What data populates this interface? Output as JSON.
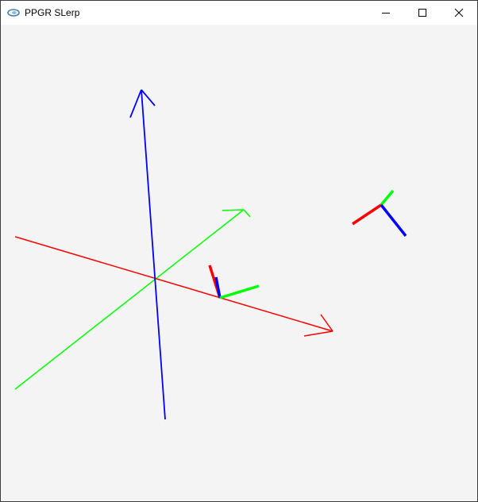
{
  "window": {
    "title": "PPGR SLerp",
    "app_icon": "opengl-app-icon",
    "controls": {
      "minimize_icon": "minimize-icon",
      "maximize_icon": "maximize-icon",
      "close_icon": "close-icon"
    }
  },
  "viewport": {
    "background": "#f4f4f4",
    "axes_colors": {
      "x": "#ff0000",
      "y": "#00ff00",
      "z": "#0000ff"
    }
  }
}
